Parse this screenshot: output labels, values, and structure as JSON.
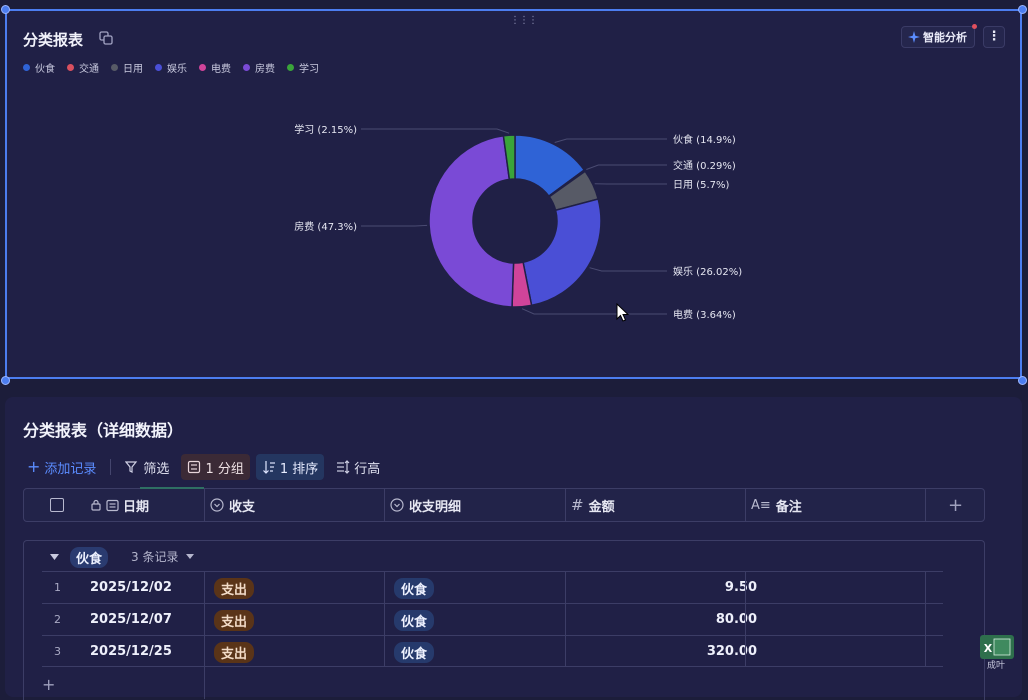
{
  "chart_card": {
    "title": "分类报表",
    "ai_button_label": "智能分析",
    "more_label": "⋮"
  },
  "chart_data": {
    "type": "pie",
    "style": "donut",
    "legend_position": "top-left",
    "slices": [
      {
        "name": "伙食",
        "value": 14.9,
        "label": "伙食 (14.9%)",
        "color": "#2f63d6"
      },
      {
        "name": "交通",
        "value": 0.29,
        "label": "交通 (0.29%)",
        "color": "#d9505f"
      },
      {
        "name": "日用",
        "value": 5.7,
        "label": "日用 (5.7%)",
        "color": "#575a66"
      },
      {
        "name": "娱乐",
        "value": 26.02,
        "label": "娱乐 (26.02%)",
        "color": "#4a4fd6"
      },
      {
        "name": "电费",
        "value": 3.64,
        "label": "电费 (3.64%)",
        "color": "#d0449a"
      },
      {
        "name": "房费",
        "value": 47.3,
        "label": "房费 (47.3%)",
        "color": "#7a4ad6"
      },
      {
        "name": "学习",
        "value": 2.15,
        "label": "学习 (2.15%)",
        "color": "#3aa43a"
      }
    ]
  },
  "table_card": {
    "title": "分类报表（详细数据）",
    "toolbar": {
      "add": "添加记录",
      "filter": "筛选",
      "group": "1 分组",
      "sort": "1 排序",
      "row_height": "行高"
    },
    "columns": [
      "日期",
      "收支",
      "收支明细",
      "金额",
      "备注"
    ],
    "add_column": "+",
    "group": {
      "name": "伙食",
      "count": "3 条记录",
      "rows": [
        {
          "index": "1",
          "date": "2025/12/02",
          "type": "支出",
          "detail": "伙食",
          "amount": "9.50",
          "note": ""
        },
        {
          "index": "2",
          "date": "2025/12/07",
          "type": "支出",
          "detail": "伙食",
          "amount": "80.00",
          "note": ""
        },
        {
          "index": "3",
          "date": "2025/12/25",
          "type": "支出",
          "detail": "伙食",
          "amount": "320.00",
          "note": ""
        }
      ]
    },
    "add_row": "+"
  },
  "excel_label": "成叶"
}
